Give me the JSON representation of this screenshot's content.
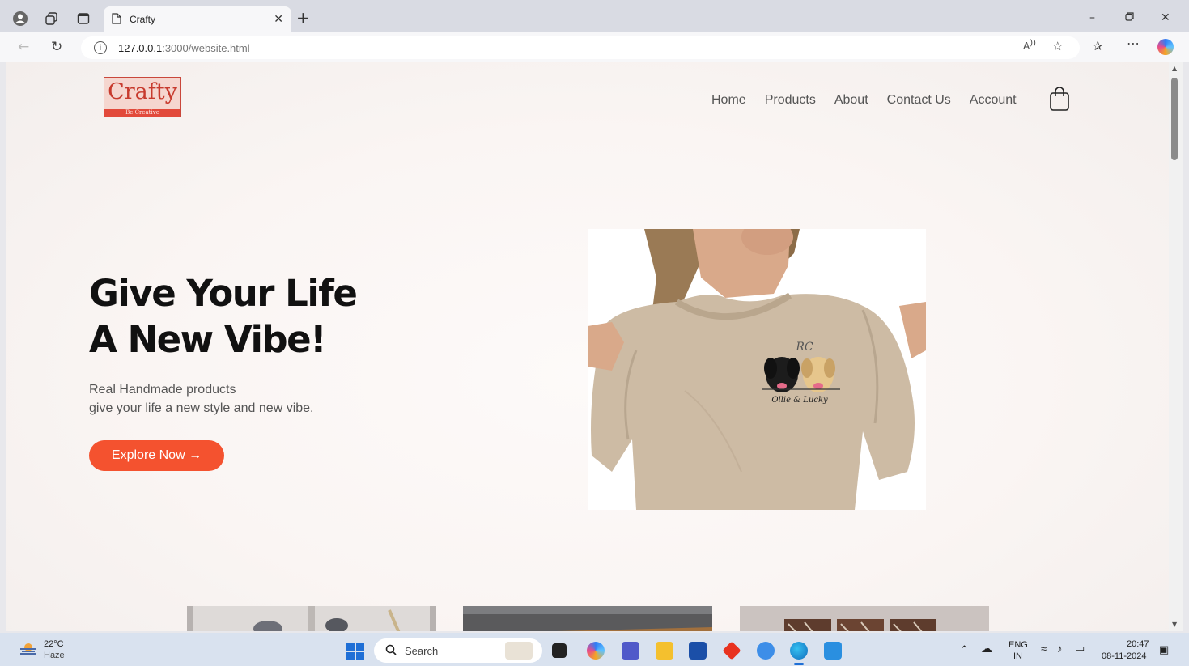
{
  "browser": {
    "tab_title": "Crafty",
    "url_host": "127.0.0.1",
    "url_path": ":3000/website.html"
  },
  "site": {
    "logo": {
      "name": "Crafty",
      "tagline": "Be Creative"
    },
    "nav": [
      "Home",
      "Products",
      "About",
      "Contact Us",
      "Account"
    ],
    "hero": {
      "title_line1": "Give Your Life",
      "title_line2": "A New Vibe!",
      "desc_line1": "Real Handmade products",
      "desc_line2": "give your life a new style and new vibe.",
      "button": "Explore Now →"
    },
    "image_caption": {
      "monogram": "RC",
      "names": "Ollie & Lucky"
    }
  },
  "taskbar": {
    "temp": "22°C",
    "condition": "Haze",
    "search_label": "Search",
    "lang_line1": "ENG",
    "lang_line2": "IN",
    "time": "20:47",
    "date": "08-11-2024"
  },
  "colors": {
    "accent": "#f4522f",
    "logo_red": "#c73a2d",
    "heading": "#111111"
  }
}
